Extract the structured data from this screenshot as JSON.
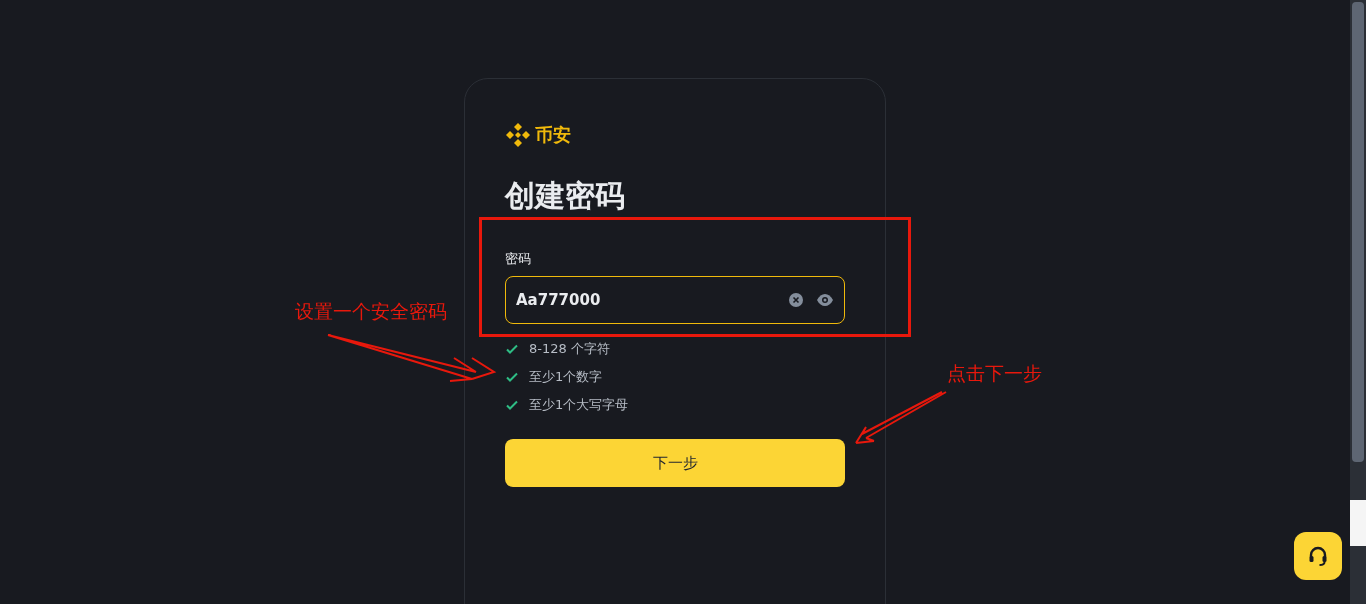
{
  "logo": {
    "text": "币安"
  },
  "title": "创建密码",
  "password_field": {
    "label": "密码",
    "value": "Aa777000",
    "focused": true
  },
  "requirements": [
    {
      "text": "8-128 个字符",
      "met": true
    },
    {
      "text": "至少1个数字",
      "met": true
    },
    {
      "text": "至少1个大写字母",
      "met": true
    }
  ],
  "next_button": {
    "label": "下一步"
  },
  "annotations": [
    {
      "text": "设置一个安全密码"
    },
    {
      "text": "点击下一步"
    }
  ]
}
